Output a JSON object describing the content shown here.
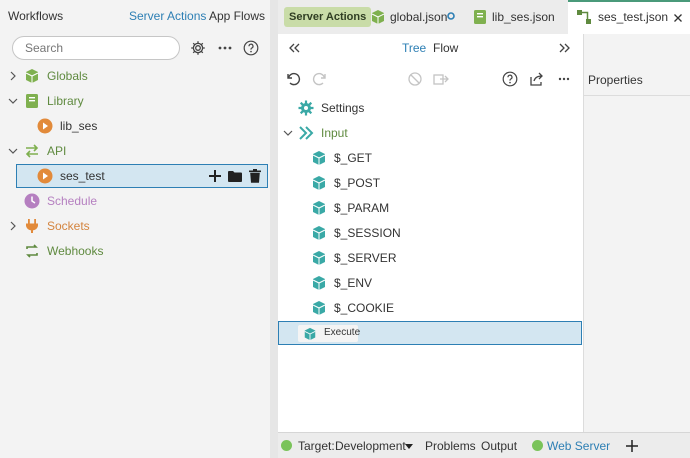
{
  "left": {
    "tabs": {
      "workflows": "Workflows",
      "server_actions": "Server Actions",
      "app_flows": "App Flows"
    },
    "search_placeholder": "Search",
    "tree": {
      "globals": "Globals",
      "library": "Library",
      "lib_ses": "lib_ses",
      "api": "API",
      "ses_test": "ses_test",
      "schedule": "Schedule",
      "sockets": "Sockets",
      "webhooks": "Webhooks"
    }
  },
  "tabs": {
    "server_actions_badge": "Server Actions",
    "global": "global.json",
    "lib_ses": "lib_ses.json",
    "ses_test": "ses_test.json"
  },
  "editor": {
    "view_tree": "Tree",
    "view_flow": "Flow",
    "settings": "Settings",
    "input": "Input",
    "inputs": [
      "$_GET",
      "$_POST",
      "$_PARAM",
      "$_SESSION",
      "$_SERVER",
      "$_ENV",
      "$_COOKIE"
    ],
    "execute": "Execute"
  },
  "properties_title": "Properties",
  "status": {
    "target_label": "Target:",
    "target_value": "Development",
    "problems": "Problems",
    "output": "Output",
    "web_server": "Web Server"
  },
  "colors": {
    "accent_green": "#5f8a3f",
    "accent_blue": "#2d7fb4",
    "teal_icon": "#3aa9a6",
    "selection_bg": "#d3e6f1",
    "selection_border": "#2d7fb4",
    "play_orange": "#e28a3a",
    "status_dot": "#7ac35a"
  }
}
